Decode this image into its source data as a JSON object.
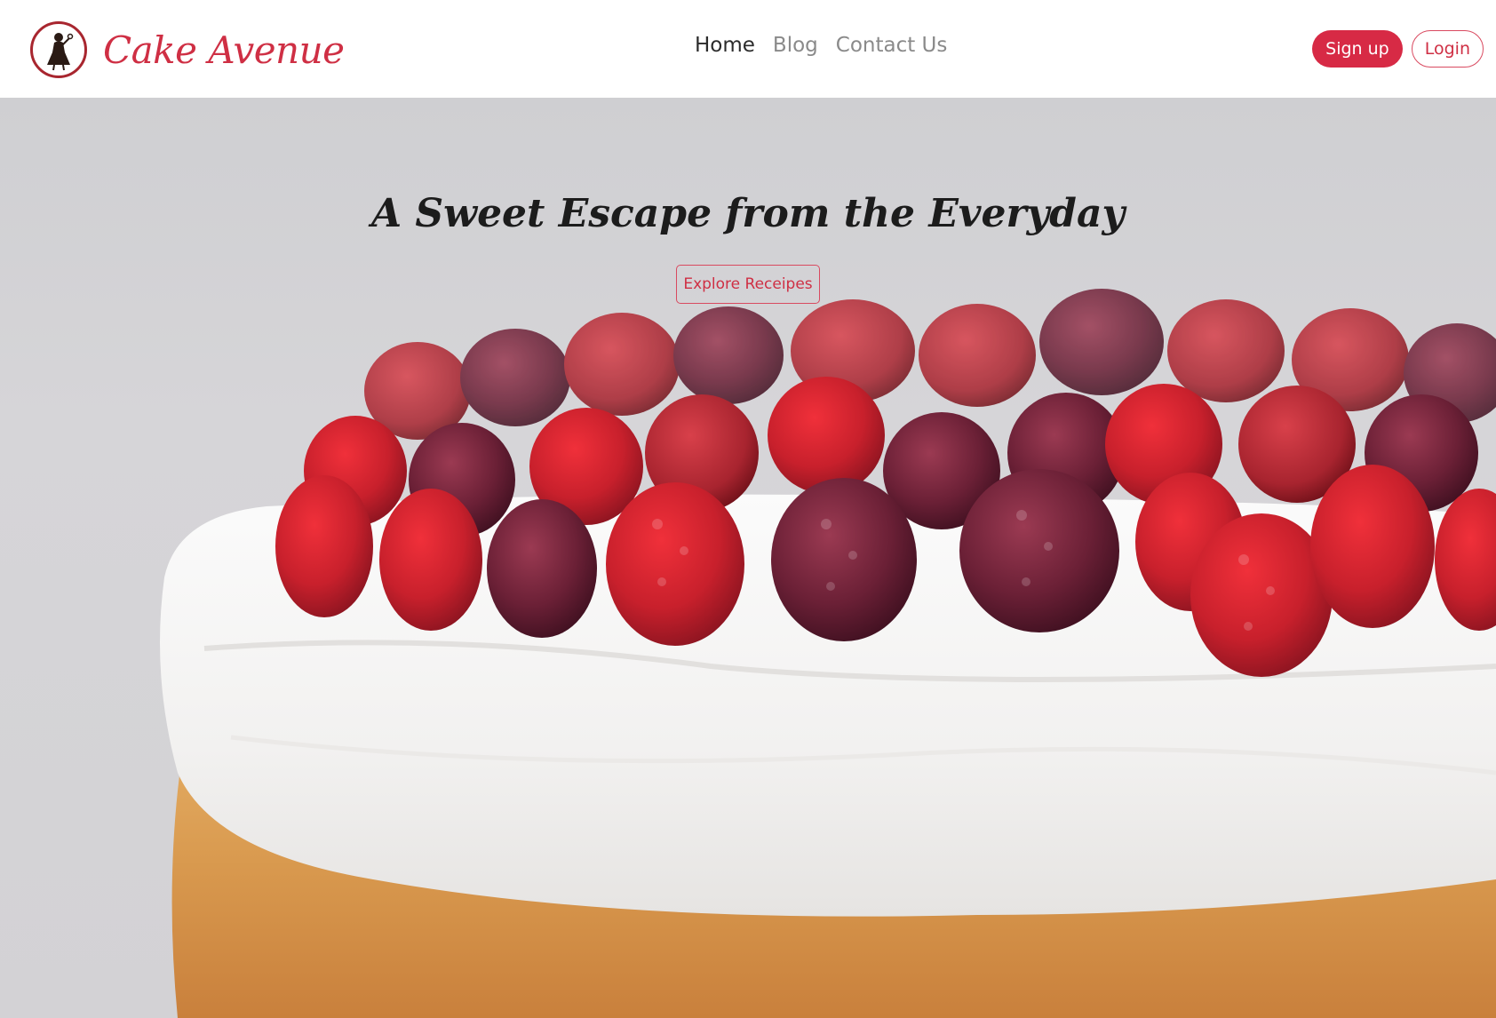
{
  "brand": {
    "name": "Cake Avenue",
    "logo_icon": "baker-silhouette-icon",
    "accent": "#d72a45"
  },
  "nav": {
    "items": [
      {
        "label": "Home",
        "active": true
      },
      {
        "label": "Blog",
        "active": false
      },
      {
        "label": "Contact Us",
        "active": false
      }
    ]
  },
  "auth": {
    "signup_label": "Sign up",
    "login_label": "Login"
  },
  "hero": {
    "title": "A Sweet Escape from the Everyday",
    "cta_label": "Explore Receipes",
    "image": "raspberry-cream-cake-photo"
  }
}
